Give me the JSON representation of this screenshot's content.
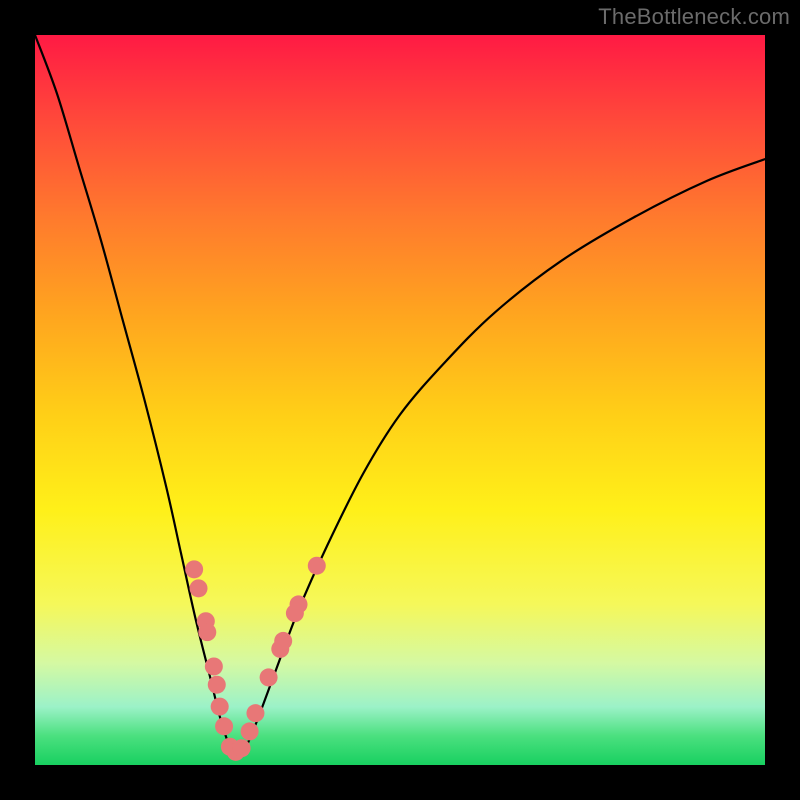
{
  "attribution": "TheBottleneck.com",
  "colors": {
    "frame": "#000000",
    "line": "#000000",
    "marker": "#e87777"
  },
  "chart_data": {
    "type": "line",
    "title": "",
    "xlabel": "",
    "ylabel": "",
    "xlim": [
      0,
      100
    ],
    "ylim": [
      0,
      100
    ],
    "grid": false,
    "series": [
      {
        "name": "curve",
        "x": [
          0,
          3,
          6,
          9,
          12,
          15,
          18,
          20,
          22,
          24,
          25.5,
          27,
          28.5,
          30,
          33,
          36,
          40,
          45,
          50,
          56,
          63,
          72,
          82,
          92,
          100
        ],
        "y": [
          100,
          92,
          82,
          72,
          61,
          50,
          38,
          29,
          20,
          12,
          6,
          2,
          2,
          5,
          13,
          21,
          30,
          40,
          48,
          55,
          62,
          69,
          75,
          80,
          83
        ]
      }
    ],
    "markers": {
      "name": "highlighted-points",
      "points": [
        {
          "x": 21.8,
          "y": 26.8
        },
        {
          "x": 22.4,
          "y": 24.2
        },
        {
          "x": 23.4,
          "y": 19.7
        },
        {
          "x": 23.6,
          "y": 18.2
        },
        {
          "x": 24.5,
          "y": 13.5
        },
        {
          "x": 24.9,
          "y": 11.0
        },
        {
          "x": 25.3,
          "y": 8.0
        },
        {
          "x": 25.9,
          "y": 5.3
        },
        {
          "x": 26.7,
          "y": 2.5
        },
        {
          "x": 27.5,
          "y": 1.8
        },
        {
          "x": 28.3,
          "y": 2.3
        },
        {
          "x": 29.4,
          "y": 4.6
        },
        {
          "x": 30.2,
          "y": 7.1
        },
        {
          "x": 32.0,
          "y": 12.0
        },
        {
          "x": 33.6,
          "y": 15.9
        },
        {
          "x": 34.0,
          "y": 17.0
        },
        {
          "x": 35.6,
          "y": 20.8
        },
        {
          "x": 36.1,
          "y": 22.0
        },
        {
          "x": 38.6,
          "y": 27.3
        }
      ]
    }
  }
}
